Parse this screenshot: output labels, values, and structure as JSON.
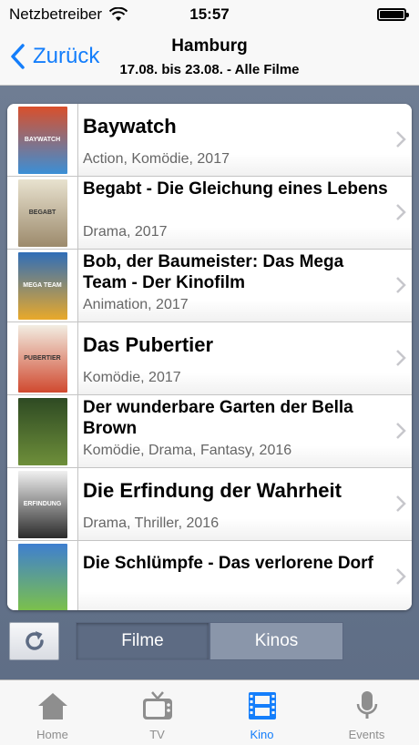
{
  "status_bar": {
    "carrier": "Netzbetreiber",
    "time": "15:57"
  },
  "nav": {
    "back_label": "Zurück",
    "title": "Hamburg",
    "subtitle": "17.08. bis 23.08. - Alle Filme"
  },
  "movies": [
    {
      "title": "Baywatch",
      "meta": "Action, Komödie, 2017",
      "poster_text": "BAYWATCH",
      "poster_colors": [
        "#d94f2b",
        "#3b8fd6"
      ]
    },
    {
      "title": "Begabt - Die Gleichung eines Lebens",
      "meta": "Drama, 2017",
      "poster_text": "BEGABT",
      "poster_colors": [
        "#e8e2cf",
        "#9c8a6c"
      ]
    },
    {
      "title": "Bob, der Baumeister: Das Mega Team - Der Kinofilm",
      "meta": "Animation, 2017",
      "poster_text": "MEGA TEAM",
      "poster_colors": [
        "#2f6db8",
        "#e9a92a"
      ]
    },
    {
      "title": "Das Pubertier",
      "meta": "Komödie, 2017",
      "poster_text": "PUBERTIER",
      "poster_colors": [
        "#f2ede2",
        "#d0492f"
      ]
    },
    {
      "title": "Der wunderbare Garten der Bella Brown",
      "meta": "Komödie, Drama, Fantasy, 2016",
      "poster_text": "",
      "poster_colors": [
        "#2e4a23",
        "#6e8f3a"
      ]
    },
    {
      "title": "Die Erfindung der Wahrheit",
      "meta": "Drama, Thriller, 2016",
      "poster_text": "ERFINDUNG",
      "poster_colors": [
        "#f0f0f0",
        "#2b2b2b"
      ]
    },
    {
      "title": "Die Schlümpfe - Das verlorene Dorf",
      "meta": "",
      "poster_text": "",
      "poster_colors": [
        "#3f7fd0",
        "#7cc14a"
      ]
    }
  ],
  "segments": {
    "left": "Filme",
    "right": "Kinos"
  },
  "tabs": [
    {
      "label": "Home",
      "icon": "house-icon",
      "active": false
    },
    {
      "label": "TV",
      "icon": "tv-icon",
      "active": false
    },
    {
      "label": "Kino",
      "icon": "film-icon",
      "active": true
    },
    {
      "label": "Events",
      "icon": "microphone-icon",
      "active": false
    }
  ],
  "colors": {
    "accent": "#147efb",
    "inactive_tab": "#8e8e8e",
    "content_bg": "#6f7d93"
  }
}
